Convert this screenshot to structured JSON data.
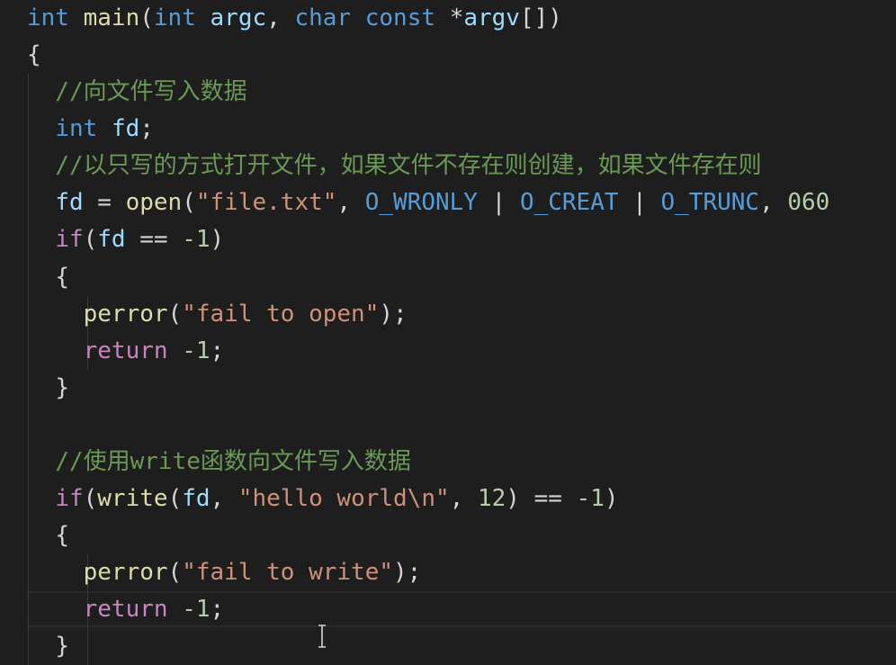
{
  "code": {
    "l1": {
      "t1": "int",
      "t2": "main",
      "t3": "(",
      "t4": "int",
      "t5": "argc",
      "t6": ", ",
      "t7": "char",
      "t8": "const",
      "t9": "*",
      "t10": "argv",
      "t11": "[])"
    },
    "l2": {
      "t1": "{"
    },
    "l3": {
      "t1": "//向文件写入数据"
    },
    "l4": {
      "t1": "int",
      "t2": "fd",
      "t3": ";"
    },
    "l5": {
      "t1": "//以只写的方式打开文件，如果文件不存在则创建，如果文件存在则"
    },
    "l6": {
      "t1": "fd",
      "t2": " = ",
      "t3": "open",
      "t4": "(",
      "t5": "\"file.txt\"",
      "t6": ", ",
      "t7": "O_WRONLY",
      "t8": " | ",
      "t9": "O_CREAT",
      "t10": " | ",
      "t11": "O_TRUNC",
      "t12": ", ",
      "t13": "060"
    },
    "l7": {
      "t1": "if",
      "t2": "(",
      "t3": "fd",
      "t4": " == ",
      "t5": "-1",
      "t6": ")"
    },
    "l8": {
      "t1": "{"
    },
    "l9": {
      "t1": "perror",
      "t2": "(",
      "t3": "\"fail to open\"",
      "t4": ");"
    },
    "l10": {
      "t1": "return",
      "t2": " ",
      "t3": "-1",
      "t4": ";"
    },
    "l11": {
      "t1": "}"
    },
    "l13": {
      "t1": "//使用write函数向文件写入数据"
    },
    "l14": {
      "t1": "if",
      "t2": "(",
      "t3": "write",
      "t4": "(",
      "t5": "fd",
      "t6": ", ",
      "t7": "\"hello world\\n\"",
      "t8": ", ",
      "t9": "12",
      "t10": ")",
      "t11": " == ",
      "t12": "-1",
      "t13": ")"
    },
    "l15": {
      "t1": "{"
    },
    "l16": {
      "t1": "perror",
      "t2": "(",
      "t3": "\"fail to write\"",
      "t4": ");"
    },
    "l17": {
      "t1": "return",
      "t2": " ",
      "t3": "-1",
      "t4": ";"
    },
    "l18": {
      "t1": "}"
    }
  },
  "colors": {
    "background": "#1e1e1e",
    "keyword": "#569cd6",
    "control": "#c586c0",
    "function": "#dcdcaa",
    "variable": "#9cdcfe",
    "string": "#ce9178",
    "number": "#b5cea8",
    "comment": "#6a9955",
    "constant": "#4fc1ff"
  },
  "icons": {
    "cursor": "text-cursor-icon"
  }
}
